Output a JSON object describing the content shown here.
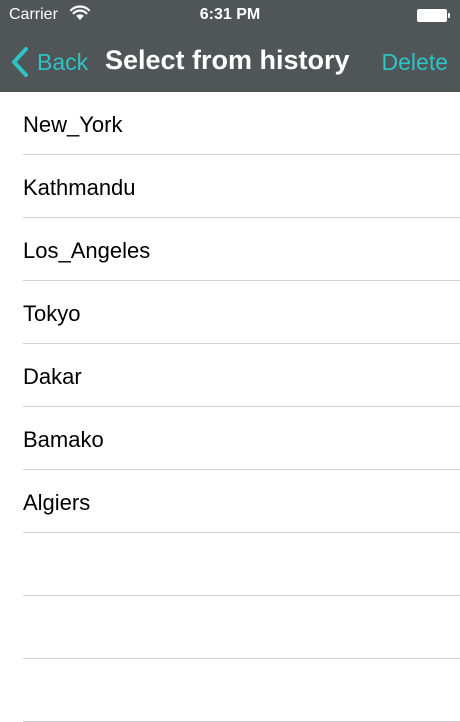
{
  "status_bar": {
    "carrier": "Carrier",
    "time": "6:31 PM",
    "wifi_icon": "wifi-icon",
    "battery_icon": "battery-icon"
  },
  "nav": {
    "back_label": "Back",
    "back_icon": "chevron-left-icon",
    "title": "Select from history",
    "delete_label": "Delete"
  },
  "history": [
    "New_York",
    "Kathmandu",
    "Los_Angeles",
    "Tokyo",
    "Dakar",
    "Bamako",
    "Algiers",
    "",
    "",
    ""
  ],
  "colors": {
    "header_bg": "#505558",
    "accent": "#2ec3c6",
    "separator": "#d2d2d6"
  }
}
